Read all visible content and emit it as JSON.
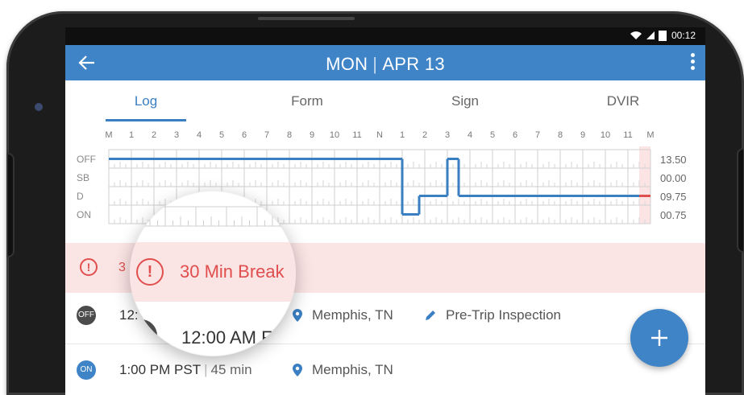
{
  "statusbar": {
    "time": "00:12"
  },
  "appbar": {
    "day": "MON",
    "date": "APR 13"
  },
  "tabs": [
    {
      "label": "Log",
      "active": true
    },
    {
      "label": "Form",
      "active": false
    },
    {
      "label": "Sign",
      "active": false
    },
    {
      "label": "DVIR",
      "active": false
    }
  ],
  "graph": {
    "hour_labels": [
      "M",
      "1",
      "2",
      "3",
      "4",
      "5",
      "6",
      "7",
      "8",
      "9",
      "10",
      "11",
      "N",
      "1",
      "2",
      "3",
      "4",
      "5",
      "6",
      "7",
      "8",
      "9",
      "10",
      "11",
      "M"
    ],
    "rows": [
      "OFF",
      "SB",
      "D",
      "ON"
    ],
    "totals": [
      "13.50",
      "00.00",
      "09.75",
      "00.75"
    ],
    "segments": [
      {
        "status": "OFF",
        "start": 0,
        "end": 13.0
      },
      {
        "status": "ON",
        "start": 13.0,
        "end": 13.75
      },
      {
        "status": "D",
        "start": 13.75,
        "end": 15.0
      },
      {
        "status": "OFF",
        "start": 15.0,
        "end": 15.5
      },
      {
        "status": "D",
        "start": 15.5,
        "end": 24.0
      }
    ],
    "current_hour": 23.5,
    "line_color": "#3a7fc2",
    "alert_color": "#e04e4e"
  },
  "alert": {
    "prefix": "3",
    "text": "30 Min Break"
  },
  "entries": [
    {
      "badge": "OFF",
      "time": "12:",
      "time_magnified": "12:00 AM F",
      "duration": "",
      "location": "Memphis, TN",
      "note": "Pre-Trip Inspection"
    },
    {
      "badge": "ON",
      "time": "1:00 PM PST",
      "duration": "45 min",
      "location": "Memphis, TN",
      "note": ""
    }
  ],
  "fab": {
    "icon": "plus-icon"
  }
}
